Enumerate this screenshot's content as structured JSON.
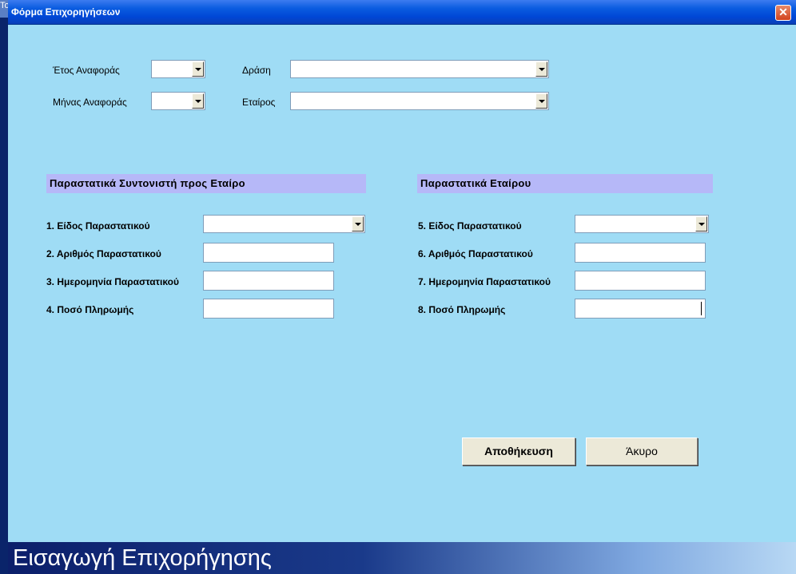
{
  "background_tab": {
    "text": "To"
  },
  "window": {
    "title": "Φόρμα Επιχορηγήσεων",
    "close_label": "✕"
  },
  "filters": {
    "year_label": "Έτος Αναφοράς",
    "year_value": "",
    "month_label": "Μήνας Αναφοράς",
    "month_value": "",
    "action_label": "Δράση",
    "action_value": "",
    "partner_label": "Εταίρος",
    "partner_value": ""
  },
  "coordinator_section": {
    "header": "Παραστατικά Συντονιστή προς Εταίρο",
    "doc_type_label": "1. Είδος Παραστατικού",
    "doc_type_value": "",
    "doc_number_label": "2. Αριθμός Παραστατικού",
    "doc_number_value": "",
    "doc_date_label": "3. Ημερομηνία Παραστατικού",
    "doc_date_value": "",
    "amount_label": "4. Ποσό Πληρωμής",
    "amount_value": ""
  },
  "partner_section": {
    "header": "Παραστατικά Εταίρου",
    "doc_type_label": "5. Είδος Παραστατικού",
    "doc_type_value": "",
    "doc_number_label": "6. Αριθμός Παραστατικού",
    "doc_number_value": "",
    "doc_date_label": "7. Ημερομηνία Παραστατικού",
    "doc_date_value": "",
    "amount_label": "8. Ποσό Πληρωμής",
    "amount_value": ""
  },
  "buttons": {
    "save": "Αποθήκευση",
    "cancel": "Άκυρο"
  },
  "footer": {
    "title": "Εισαγωγή Επιχορήγησης"
  },
  "colors": {
    "form_background": "#9fdcf5",
    "section_header": "#b6b8f8",
    "titlebar": "#0047d6",
    "footer_start": "#0c1f6a",
    "footer_end": "#b8d8f4"
  }
}
